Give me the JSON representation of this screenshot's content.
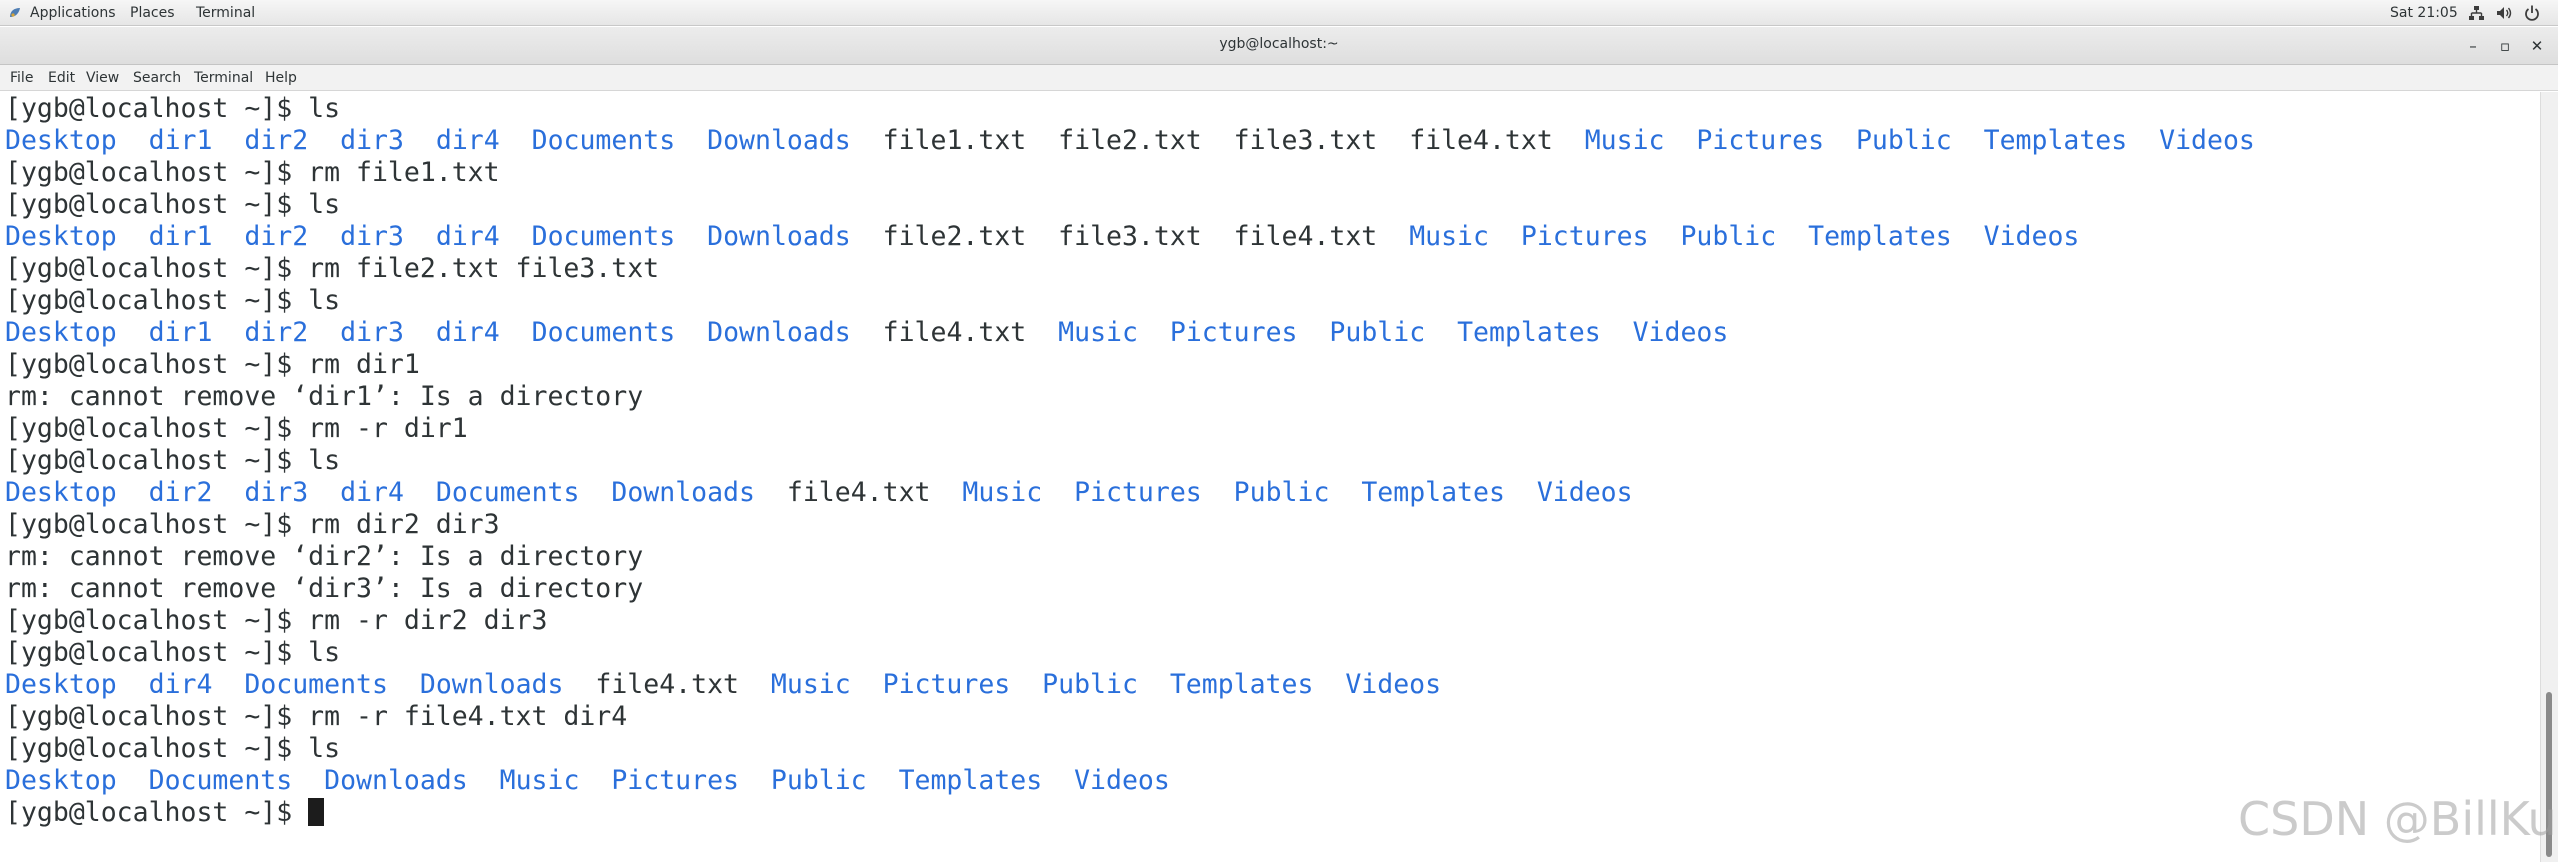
{
  "topbar": {
    "applications": "Applications",
    "places": "Places",
    "terminal": "Terminal",
    "clock": "Sat 21:05",
    "icons": [
      "network-icon",
      "volume-icon",
      "power-icon"
    ]
  },
  "window": {
    "title": "ygb@localhost:~",
    "minimize": "–",
    "maximize": "▫",
    "close": "✕"
  },
  "menubar": [
    "File",
    "Edit",
    "View",
    "Search",
    "Terminal",
    "Help"
  ],
  "colors": {
    "directory": "#2a6fdb",
    "text": "#2e3436",
    "background": "#ffffff"
  },
  "terminal": {
    "lines": [
      {
        "kind": "cmd",
        "text": "[ygb@localhost ~]$ ls"
      },
      {
        "kind": "ls",
        "entries": [
          {
            "name": "Desktop",
            "type": "dir"
          },
          {
            "name": "dir1",
            "type": "dir"
          },
          {
            "name": "dir2",
            "type": "dir"
          },
          {
            "name": "dir3",
            "type": "dir"
          },
          {
            "name": "dir4",
            "type": "dir"
          },
          {
            "name": "Documents",
            "type": "dir"
          },
          {
            "name": "Downloads",
            "type": "dir"
          },
          {
            "name": "file1.txt",
            "type": "file"
          },
          {
            "name": "file2.txt",
            "type": "file"
          },
          {
            "name": "file3.txt",
            "type": "file"
          },
          {
            "name": "file4.txt",
            "type": "file"
          },
          {
            "name": "Music",
            "type": "dir"
          },
          {
            "name": "Pictures",
            "type": "dir"
          },
          {
            "name": "Public",
            "type": "dir"
          },
          {
            "name": "Templates",
            "type": "dir"
          },
          {
            "name": "Videos",
            "type": "dir"
          }
        ]
      },
      {
        "kind": "cmd",
        "text": "[ygb@localhost ~]$ rm file1.txt"
      },
      {
        "kind": "cmd",
        "text": "[ygb@localhost ~]$ ls"
      },
      {
        "kind": "ls",
        "entries": [
          {
            "name": "Desktop",
            "type": "dir"
          },
          {
            "name": "dir1",
            "type": "dir"
          },
          {
            "name": "dir2",
            "type": "dir"
          },
          {
            "name": "dir3",
            "type": "dir"
          },
          {
            "name": "dir4",
            "type": "dir"
          },
          {
            "name": "Documents",
            "type": "dir"
          },
          {
            "name": "Downloads",
            "type": "dir"
          },
          {
            "name": "file2.txt",
            "type": "file"
          },
          {
            "name": "file3.txt",
            "type": "file"
          },
          {
            "name": "file4.txt",
            "type": "file"
          },
          {
            "name": "Music",
            "type": "dir"
          },
          {
            "name": "Pictures",
            "type": "dir"
          },
          {
            "name": "Public",
            "type": "dir"
          },
          {
            "name": "Templates",
            "type": "dir"
          },
          {
            "name": "Videos",
            "type": "dir"
          }
        ]
      },
      {
        "kind": "cmd",
        "text": "[ygb@localhost ~]$ rm file2.txt file3.txt"
      },
      {
        "kind": "cmd",
        "text": "[ygb@localhost ~]$ ls"
      },
      {
        "kind": "ls",
        "entries": [
          {
            "name": "Desktop",
            "type": "dir"
          },
          {
            "name": "dir1",
            "type": "dir"
          },
          {
            "name": "dir2",
            "type": "dir"
          },
          {
            "name": "dir3",
            "type": "dir"
          },
          {
            "name": "dir4",
            "type": "dir"
          },
          {
            "name": "Documents",
            "type": "dir"
          },
          {
            "name": "Downloads",
            "type": "dir"
          },
          {
            "name": "file4.txt",
            "type": "file"
          },
          {
            "name": "Music",
            "type": "dir"
          },
          {
            "name": "Pictures",
            "type": "dir"
          },
          {
            "name": "Public",
            "type": "dir"
          },
          {
            "name": "Templates",
            "type": "dir"
          },
          {
            "name": "Videos",
            "type": "dir"
          }
        ]
      },
      {
        "kind": "cmd",
        "text": "[ygb@localhost ~]$ rm dir1"
      },
      {
        "kind": "out",
        "text": "rm: cannot remove ‘dir1’: Is a directory"
      },
      {
        "kind": "cmd",
        "text": "[ygb@localhost ~]$ rm -r dir1"
      },
      {
        "kind": "cmd",
        "text": "[ygb@localhost ~]$ ls"
      },
      {
        "kind": "ls",
        "entries": [
          {
            "name": "Desktop",
            "type": "dir"
          },
          {
            "name": "dir2",
            "type": "dir"
          },
          {
            "name": "dir3",
            "type": "dir"
          },
          {
            "name": "dir4",
            "type": "dir"
          },
          {
            "name": "Documents",
            "type": "dir"
          },
          {
            "name": "Downloads",
            "type": "dir"
          },
          {
            "name": "file4.txt",
            "type": "file"
          },
          {
            "name": "Music",
            "type": "dir"
          },
          {
            "name": "Pictures",
            "type": "dir"
          },
          {
            "name": "Public",
            "type": "dir"
          },
          {
            "name": "Templates",
            "type": "dir"
          },
          {
            "name": "Videos",
            "type": "dir"
          }
        ]
      },
      {
        "kind": "cmd",
        "text": "[ygb@localhost ~]$ rm dir2 dir3"
      },
      {
        "kind": "out",
        "text": "rm: cannot remove ‘dir2’: Is a directory"
      },
      {
        "kind": "out",
        "text": "rm: cannot remove ‘dir3’: Is a directory"
      },
      {
        "kind": "cmd",
        "text": "[ygb@localhost ~]$ rm -r dir2 dir3"
      },
      {
        "kind": "cmd",
        "text": "[ygb@localhost ~]$ ls"
      },
      {
        "kind": "ls",
        "entries": [
          {
            "name": "Desktop",
            "type": "dir"
          },
          {
            "name": "dir4",
            "type": "dir"
          },
          {
            "name": "Documents",
            "type": "dir"
          },
          {
            "name": "Downloads",
            "type": "dir"
          },
          {
            "name": "file4.txt",
            "type": "file"
          },
          {
            "name": "Music",
            "type": "dir"
          },
          {
            "name": "Pictures",
            "type": "dir"
          },
          {
            "name": "Public",
            "type": "dir"
          },
          {
            "name": "Templates",
            "type": "dir"
          },
          {
            "name": "Videos",
            "type": "dir"
          }
        ]
      },
      {
        "kind": "cmd",
        "text": "[ygb@localhost ~]$ rm -r file4.txt dir4"
      },
      {
        "kind": "cmd",
        "text": "[ygb@localhost ~]$ ls"
      },
      {
        "kind": "ls",
        "entries": [
          {
            "name": "Desktop",
            "type": "dir"
          },
          {
            "name": "Documents",
            "type": "dir"
          },
          {
            "name": "Downloads",
            "type": "dir"
          },
          {
            "name": "Music",
            "type": "dir"
          },
          {
            "name": "Pictures",
            "type": "dir"
          },
          {
            "name": "Public",
            "type": "dir"
          },
          {
            "name": "Templates",
            "type": "dir"
          },
          {
            "name": "Videos",
            "type": "dir"
          }
        ]
      },
      {
        "kind": "prompt",
        "text": "[ygb@localhost ~]$ "
      }
    ]
  },
  "watermark": "CSDN @BillKu"
}
